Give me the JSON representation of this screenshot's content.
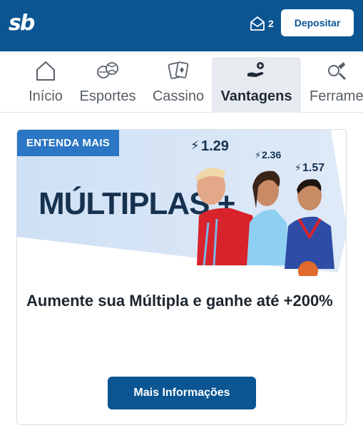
{
  "header": {
    "logo_text": "sb",
    "inbox_count": "2",
    "deposit_label": "Depositar",
    "brand_color": "#0b5593"
  },
  "tabs": [
    {
      "label": "Início",
      "icon": "home-icon",
      "active": false
    },
    {
      "label": "Esportes",
      "icon": "sports-balls-icon",
      "active": false
    },
    {
      "label": "Cassino",
      "icon": "playing-cards-icon",
      "active": false
    },
    {
      "label": "Vantagens",
      "icon": "hand-coin-icon",
      "active": true
    },
    {
      "label": "Ferrame",
      "icon": "tools-icon",
      "active": false
    }
  ],
  "promo": {
    "badge": "ENTENDA MAIS",
    "banner_headline": "MÚLTIPLAS +",
    "odds": [
      "1.29",
      "2.36",
      "1.57"
    ],
    "title": "Aumente sua Múltipla e ganhe até +200%",
    "button_label": "Mais Informações"
  }
}
